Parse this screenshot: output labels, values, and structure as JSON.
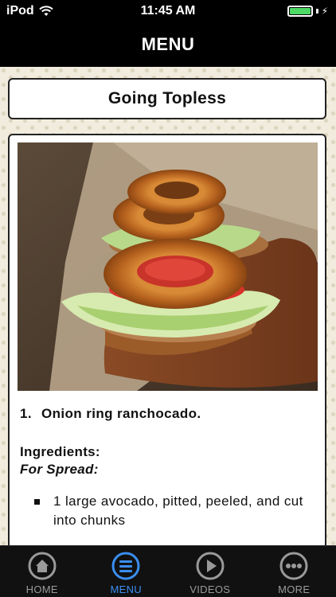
{
  "status_bar": {
    "carrier": "iPod",
    "time": "11:45 AM"
  },
  "nav": {
    "title": "MENU"
  },
  "content": {
    "title": "Going Topless",
    "photo_icon": "onion-ring-sandwich-photo",
    "step_number": "1.",
    "step_title": "Onion ring ranchocado.",
    "ingredients_label": "Ingredients:",
    "spread_label": "For Spread:",
    "ingredients": [
      "1 large avocado, pitted, peeled, and cut into chunks"
    ]
  },
  "tabs": [
    {
      "label": "HOME",
      "icon": "home-icon",
      "active": false
    },
    {
      "label": "MENU",
      "icon": "menu-icon",
      "active": true
    },
    {
      "label": "VIDEOS",
      "icon": "play-icon",
      "active": false
    },
    {
      "label": "MORE",
      "icon": "more-icon",
      "active": false
    }
  ],
  "colors": {
    "active_tab": "#3a8ef0",
    "inactive_tab": "#9a9a9a",
    "battery": "#4cd964",
    "bar_background": "#000000",
    "content_background": "#f1ecdd"
  }
}
